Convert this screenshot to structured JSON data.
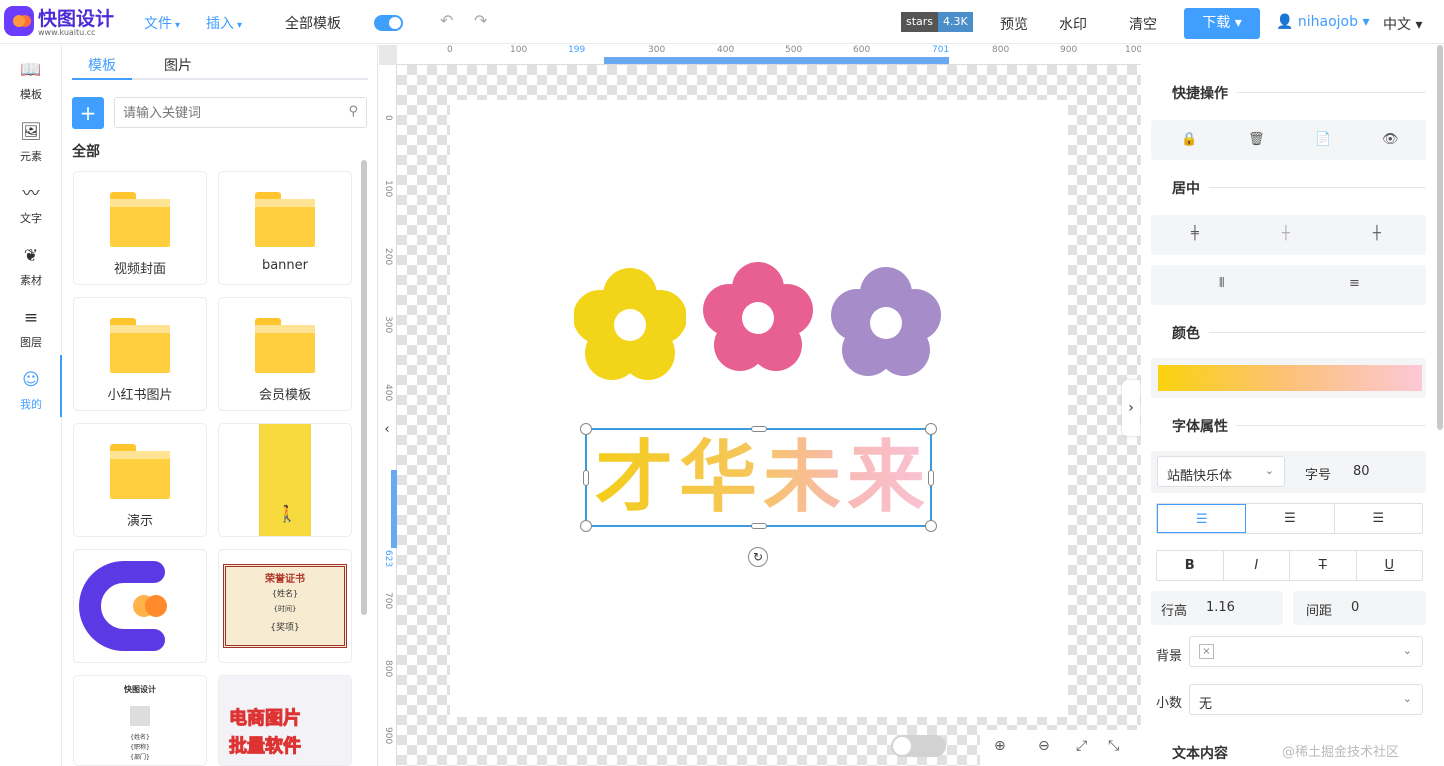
{
  "header": {
    "logo_text": "快图设计",
    "logo_sub": "www.kuaitu.cc",
    "menu_file": "文件",
    "menu_insert": "插入",
    "all_templates": "全部模板",
    "stars_label": "stars",
    "stars_count": "4.3K",
    "preview": "预览",
    "watermark": "水印",
    "clear": "清空",
    "download": "下载",
    "username": "nihaojob",
    "language": "中文"
  },
  "leftnav": {
    "items": [
      {
        "label": "模板",
        "icon": "book-icon"
      },
      {
        "label": "元素",
        "icon": "image-icon"
      },
      {
        "label": "文字",
        "icon": "pulse-icon"
      },
      {
        "label": "素材",
        "icon": "leaf-icon"
      },
      {
        "label": "图层",
        "icon": "layers-icon"
      },
      {
        "label": "我的",
        "icon": "user-circle-icon"
      }
    ],
    "active": "我的"
  },
  "panel": {
    "tabs": [
      "模板",
      "图片"
    ],
    "active_tab": "模板",
    "add_label": "+",
    "search_placeholder": "请输入关键词",
    "section_label": "全部",
    "cards": [
      {
        "type": "folder",
        "label": "视频封面"
      },
      {
        "type": "folder",
        "label": "banner"
      },
      {
        "type": "folder",
        "label": "小红书图片"
      },
      {
        "type": "folder",
        "label": "会员模板"
      },
      {
        "type": "folder",
        "label": "演示"
      },
      {
        "type": "image",
        "label": ""
      },
      {
        "type": "image",
        "label": ""
      },
      {
        "type": "image",
        "label": ""
      },
      {
        "type": "image",
        "label": ""
      },
      {
        "type": "image",
        "label": ""
      }
    ],
    "certificate": {
      "title": "荣誉证书",
      "name": "{姓名}",
      "time": "{时间}",
      "award": "{奖项}"
    },
    "resume_thumb": {
      "title": "快图设计",
      "name": "{姓名}",
      "sub1": "{职称}",
      "sub2": "{部门}"
    },
    "ecommerce_thumb": {
      "line1": "电商图片",
      "line2": "批量软件"
    }
  },
  "canvas": {
    "ruler_top": [
      "0",
      "100",
      "199",
      "300",
      "400",
      "500",
      "600",
      "701",
      "800",
      "900",
      "100"
    ],
    "ruler_left": [
      "0",
      "100",
      "200",
      "300",
      "400",
      "623",
      "700",
      "800",
      "900"
    ],
    "text_element": "才华未来",
    "flowers": [
      "yellow",
      "pink",
      "purple"
    ],
    "flower_colors": [
      "#f2d419",
      "#e85f92",
      "#a68cc8"
    ]
  },
  "rightpanel": {
    "quick_ops": "快捷操作",
    "center": "居中",
    "color": "颜色",
    "font_props": "字体属性",
    "font_family": "站酷快乐体",
    "font_size_label": "字号",
    "font_size": "80",
    "line_height_label": "行高",
    "line_height": "1.16",
    "spacing_label": "间距",
    "spacing": "0",
    "bg_label": "背景",
    "bg_value": "×",
    "decimal_label": "小数",
    "decimal_value": "无",
    "text_content": "文本内容",
    "gradient_colors": [
      "#fbd20e",
      "#fcc17a",
      "#fcc8d6"
    ],
    "bold": "B",
    "italic": "I",
    "strike": "T",
    "underline": "U"
  },
  "watermark_text": "@稀土掘金技术社区"
}
